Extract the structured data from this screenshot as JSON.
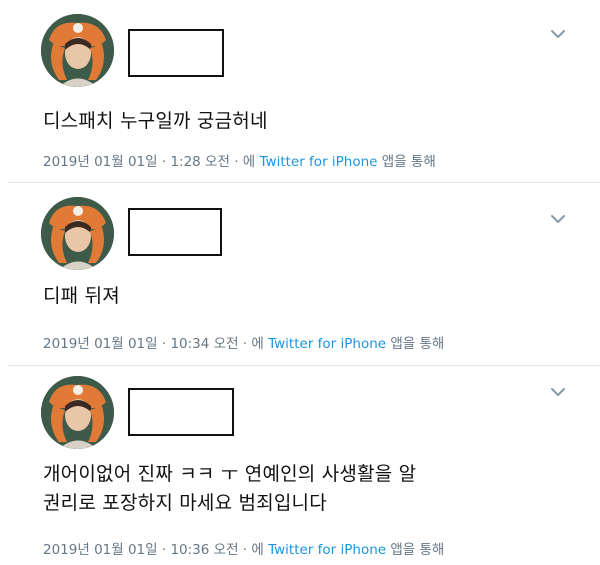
{
  "tweets": [
    {
      "text_lines": [
        "디스패치 누구일까 궁금허네"
      ],
      "date": "2019년 01월 01일",
      "time": "1:28 오전",
      "via_prefix": "에",
      "source": "Twitter for iPhone",
      "via_suffix": "앱을 통해",
      "sep": "·"
    },
    {
      "text_lines": [
        "디패 뒤져"
      ],
      "date": "2019년 01월 01일",
      "time": "10:34 오전",
      "via_prefix": "에",
      "source": "Twitter for iPhone",
      "via_suffix": "앱을 통해",
      "sep": "·"
    },
    {
      "text_lines": [
        "개어이없어 진짜 ㅋㅋ ㅜ 연예인의 사생활을 알",
        "권리로 포장하지 마세요 범죄입니다"
      ],
      "date": "2019년 01월 01일",
      "time": "10:36 오전",
      "via_prefix": "에",
      "source": "Twitter for iPhone",
      "via_suffix": "앱을 통해",
      "sep": "·"
    }
  ],
  "icons": {
    "menu": "chevron-down-icon",
    "avatar": "avatar-image"
  },
  "colors": {
    "link": "#1b95e0",
    "meta": "#657786",
    "divider": "#e1e8ed"
  }
}
